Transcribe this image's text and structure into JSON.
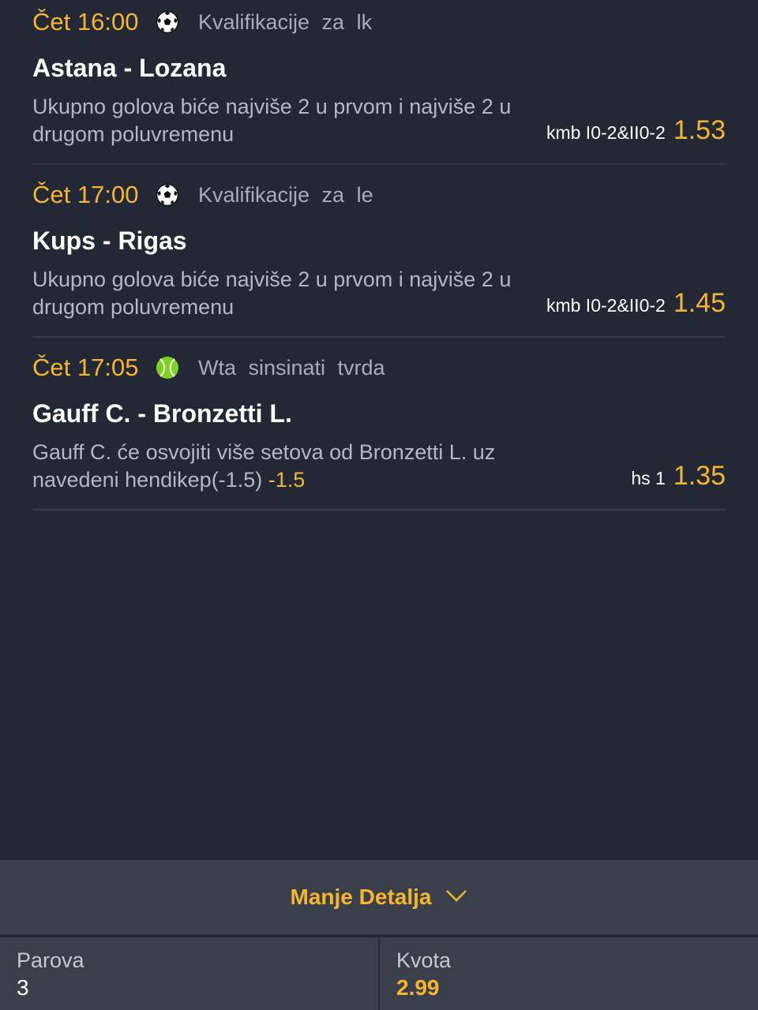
{
  "matches": [
    {
      "time": "Čet 16:00",
      "sport_icon": "soccer-ball-icon",
      "league": "Kvalifikacije  za  lk",
      "teams": "Astana - Lozana",
      "description": "Ukupno golova biće najviše 2 u prvom i najviše 2 u drugom poluvremenu",
      "handicap": "",
      "code": "kmb I0-2&II0-2",
      "odd": "1.53"
    },
    {
      "time": "Čet 17:00",
      "sport_icon": "soccer-ball-icon",
      "league": "Kvalifikacije  za  le",
      "teams": "Kups - Rigas",
      "description": "Ukupno golova biće najviše 2 u prvom i najviše 2 u drugom poluvremenu",
      "handicap": "",
      "code": "kmb I0-2&II0-2",
      "odd": "1.45"
    },
    {
      "time": "Čet 17:05",
      "sport_icon": "tennis-ball-icon",
      "league": "Wta  sinsinati  tvrda",
      "teams": "Gauff C. - Bronzetti L.",
      "description": "Gauff C. će osvojiti više setova od Bronzetti L. uz navedeni hendikep(-1.5)",
      "handicap": "-1.5",
      "code": "hs 1",
      "odd": "1.35"
    }
  ],
  "toggle": {
    "label": "Manje Detalja",
    "icon": "chevron-down-icon"
  },
  "summary": {
    "pairs_label": "Parova",
    "pairs_value": "3",
    "odds_label": "Kvota",
    "odds_value": "2.99"
  },
  "colors": {
    "accent": "#f6b62b",
    "background": "#222836",
    "panel": "#3a3f4c"
  }
}
